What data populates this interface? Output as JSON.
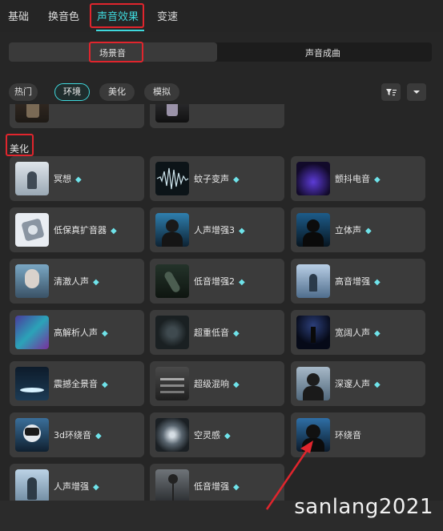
{
  "tabs": [
    "基础",
    "换音色",
    "声音效果",
    "变速"
  ],
  "subtabs": [
    "场景音",
    "声音成曲"
  ],
  "chips": [
    "热门",
    "环境",
    "美化",
    "模拟"
  ],
  "section_label": "美化",
  "colors": {
    "accent": "#3fd8dc",
    "highlight": "#e0252d",
    "card": "#3b3b3b",
    "bg": "#262626"
  },
  "premium_icon": "diamond-icon",
  "cards_partial": [
    {
      "label": "",
      "premium": false
    },
    {
      "label": "",
      "premium": false
    }
  ],
  "cards": [
    {
      "label": "冥想",
      "premium": true,
      "thumb": "meditate"
    },
    {
      "label": "蚊子变声",
      "premium": true,
      "thumb": "wave"
    },
    {
      "label": "颤抖电音",
      "premium": true,
      "thumb": "purple"
    },
    {
      "label": "低保真扩音器",
      "premium": true,
      "thumb": "speaker"
    },
    {
      "label": "人声增强3",
      "premium": true,
      "thumb": "portrait"
    },
    {
      "label": "立体声",
      "premium": true,
      "thumb": "portrait-dark"
    },
    {
      "label": "清澈人声",
      "premium": true,
      "thumb": "face"
    },
    {
      "label": "低音增强2",
      "premium": true,
      "thumb": "bottle"
    },
    {
      "label": "高音增强",
      "premium": true,
      "thumb": "figure"
    },
    {
      "label": "高解析人声",
      "premium": true,
      "thumb": "glitch"
    },
    {
      "label": "超重低音",
      "premium": false,
      "thumb": "sub"
    },
    {
      "label": "宽阔人声",
      "premium": true,
      "thumb": "stage"
    },
    {
      "label": "震撼全景音",
      "premium": true,
      "thumb": "lights"
    },
    {
      "label": "超级混响",
      "premium": true,
      "thumb": "mixer"
    },
    {
      "label": "深邃人声",
      "premium": true,
      "thumb": "person"
    },
    {
      "label": "3d环绕音",
      "premium": true,
      "thumb": "helmet"
    },
    {
      "label": "空灵感",
      "premium": true,
      "thumb": "swirl"
    },
    {
      "label": "环绕音",
      "premium": false,
      "thumb": "headphone"
    },
    {
      "label": "人声增强",
      "premium": true,
      "thumb": "sky"
    },
    {
      "label": "低音增强",
      "premium": true,
      "thumb": "mic"
    }
  ],
  "watermark": "sanlang2021"
}
